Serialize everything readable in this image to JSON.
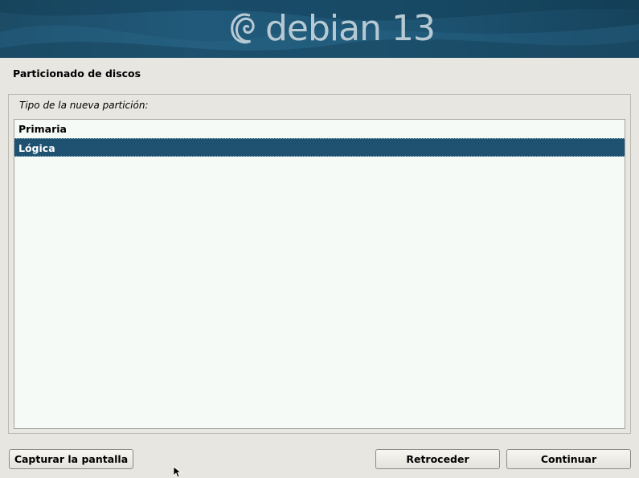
{
  "banner": {
    "logo_text": "debian 13"
  },
  "page": {
    "title": "Particionado de discos"
  },
  "prompt": {
    "question": "Tipo de la nueva partición:"
  },
  "options": [
    {
      "label": "Primaria",
      "selected": false
    },
    {
      "label": "Lógica",
      "selected": true
    }
  ],
  "buttons": {
    "screenshot": "Capturar la pantalla",
    "back": "Retroceder",
    "continue": "Continuar"
  },
  "colors": {
    "banner": "#1e5675",
    "selection": "#1f5170",
    "background": "#e8e6e0",
    "list_background": "#f6faf7"
  }
}
